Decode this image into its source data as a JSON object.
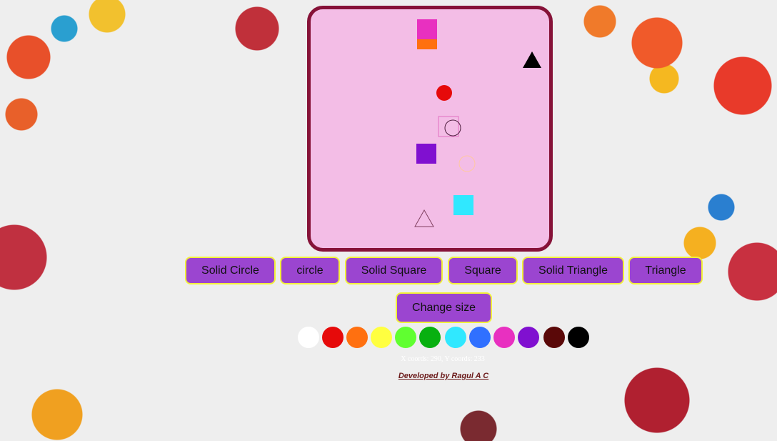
{
  "buttons": {
    "solid_circle": "Solid Circle",
    "circle": "circle",
    "solid_square": "Solid Square",
    "square": "Square",
    "solid_triangle": "Solid Triangle",
    "triangle": "Triangle",
    "change_size": "Change size"
  },
  "palette": [
    "#ffffff",
    "#e60a0a",
    "#ff7010",
    "#ffff40",
    "#60ff30",
    "#08b010",
    "#30e8ff",
    "#3070ff",
    "#e830c0",
    "#8010d0",
    "#5a0808",
    "#000000"
  ],
  "coords_text": "X coords: 290, Y coords: 233",
  "footer": "Developed by Ragul A C",
  "canvas": {
    "background": "#f3bde6",
    "border": "#861238",
    "shapes": [
      {
        "type": "solid-square",
        "color": "#ff7010"
      },
      {
        "type": "solid-square",
        "color": "#e830c0"
      },
      {
        "type": "solid-triangle",
        "color": "#000000"
      },
      {
        "type": "solid-circle",
        "color": "#e60a0a"
      },
      {
        "type": "square",
        "color": "#e070c0"
      },
      {
        "type": "circle",
        "color": "#502040"
      },
      {
        "type": "solid-square",
        "color": "#8010d0"
      },
      {
        "type": "circle",
        "color": "#ffc8a0"
      },
      {
        "type": "solid-square",
        "color": "#30e8ff"
      },
      {
        "type": "triangle",
        "color": "#804060"
      }
    ]
  }
}
